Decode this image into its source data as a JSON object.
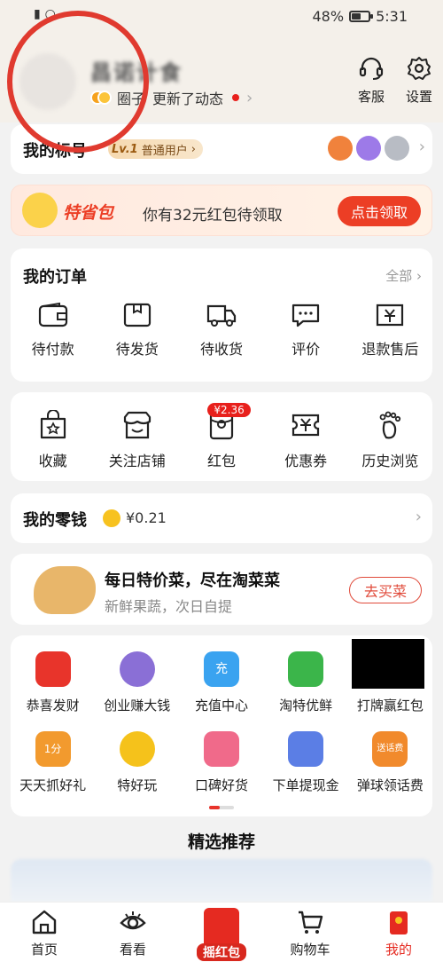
{
  "status": {
    "battery": "48%",
    "time": "5:31",
    "battery_level": 0.48
  },
  "header": {
    "username": "昌诺计食",
    "circle_label": "圈子",
    "update_text": "更新了动态",
    "service_label": "客服",
    "settings_label": "设置"
  },
  "account": {
    "title": "我的标号",
    "level": "Lv.1",
    "level_text": "普通用户"
  },
  "promo": {
    "brand": "特省包",
    "text": "你有32元红包待领取",
    "button": "点击领取"
  },
  "orders": {
    "title": "我的订单",
    "all_label": "全部",
    "items": [
      {
        "label": "待付款",
        "icon": "wallet-icon"
      },
      {
        "label": "待发货",
        "icon": "box-icon"
      },
      {
        "label": "待收货",
        "icon": "truck-icon"
      },
      {
        "label": "评价",
        "icon": "comment-icon"
      },
      {
        "label": "退款售后",
        "icon": "refund-icon"
      }
    ]
  },
  "shortcuts": {
    "items": [
      {
        "label": "收藏",
        "icon": "favorite-bag-icon"
      },
      {
        "label": "关注店铺",
        "icon": "store-icon"
      },
      {
        "label": "红包",
        "icon": "red-packet-icon",
        "badge": "¥2.36"
      },
      {
        "label": "优惠券",
        "icon": "coupon-icon"
      },
      {
        "label": "历史浏览",
        "icon": "footprint-icon"
      }
    ]
  },
  "wallet": {
    "title": "我的零钱",
    "amount": "¥0.21"
  },
  "veg": {
    "title": "每日特价菜，尽在淘菜菜",
    "subtitle": "新鲜果蔬，次日自提",
    "button": "去买菜"
  },
  "apps": {
    "row1": [
      {
        "label": "恭喜发财",
        "icon": "red-envelope-icon",
        "color": "#e8342b"
      },
      {
        "label": "创业赚大钱",
        "icon": "girl-avatar-icon",
        "color": "#8a6fd6"
      },
      {
        "label": "充值中心",
        "icon": "phone-charge-icon",
        "color": "#3aa3f0",
        "glyph": "充"
      },
      {
        "label": "淘特优鲜",
        "icon": "fresh-basket-icon",
        "color": "#3bb54a"
      },
      {
        "label": "打牌赢红包",
        "icon": "card-game-icon",
        "color": "#000000"
      }
    ],
    "row2": [
      {
        "label": "天天抓好礼",
        "icon": "claw-gift-icon",
        "color": "#f29a2e",
        "glyph": "1分"
      },
      {
        "label": "特好玩",
        "icon": "corn-mascot-icon",
        "color": "#f5c21b"
      },
      {
        "label": "口碑好货",
        "icon": "thumbs-up-icon",
        "color": "#f06a8a"
      },
      {
        "label": "下单提现金",
        "icon": "shopping-cart-icon",
        "color": "#5b7ee5"
      },
      {
        "label": "弹球领话费",
        "icon": "fox-icon",
        "color": "#f18a2c",
        "glyph": "送话费"
      }
    ]
  },
  "recommend": {
    "title": "精选推荐"
  },
  "bottom_nav": [
    {
      "label": "首页",
      "icon": "home-icon"
    },
    {
      "label": "看看",
      "icon": "eye-icon"
    },
    {
      "label": "摇红包",
      "icon": "shake-red-packet-icon"
    },
    {
      "label": "购物车",
      "icon": "cart-icon"
    },
    {
      "label": "我的",
      "icon": "profile-icon"
    }
  ],
  "colors": {
    "accent": "#ec3e25",
    "annotation": "#e03a2f",
    "background": "#f2f2f2"
  }
}
